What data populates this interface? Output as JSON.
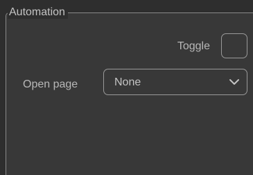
{
  "panel": {
    "title": "Automation"
  },
  "toggle": {
    "label": "Toggle",
    "checked": false
  },
  "open_page": {
    "label": "Open page",
    "selected": "None",
    "icon": "chevron-down-icon"
  }
}
